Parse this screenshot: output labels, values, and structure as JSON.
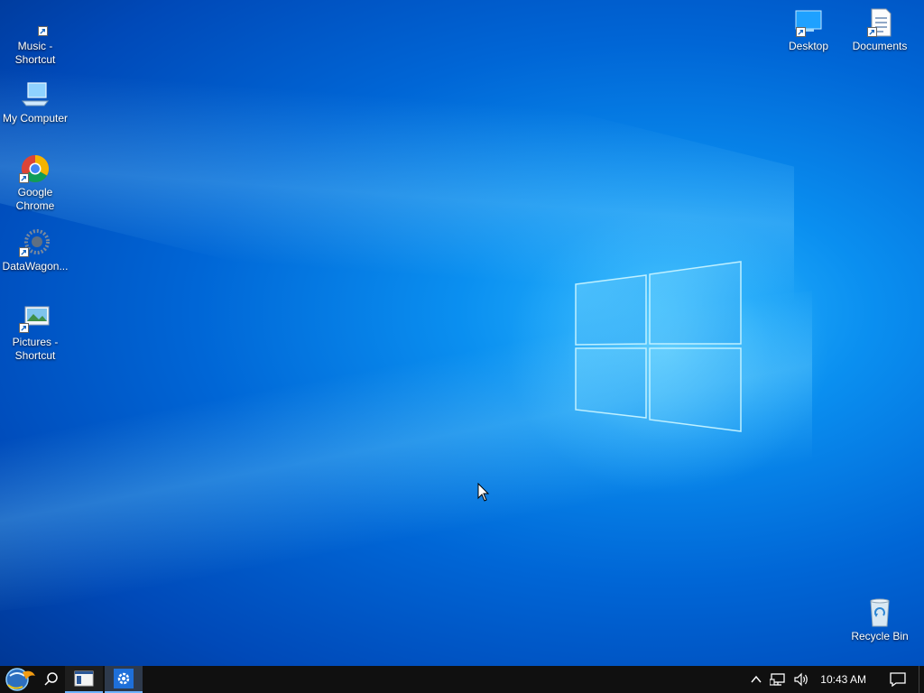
{
  "desktop": {
    "left_icons": [
      {
        "label": "Music - Shortcut",
        "icon": "music-shortcut-icon"
      },
      {
        "label": "My Computer",
        "icon": "computer-icon"
      },
      {
        "label": "Google Chrome",
        "icon": "chrome-icon"
      },
      {
        "label": "DataWagon...",
        "icon": "datawagon-icon"
      },
      {
        "label": "Pictures - Shortcut",
        "icon": "pictures-icon"
      }
    ],
    "right_icons": [
      {
        "label": "Desktop",
        "icon": "desktop-folder-icon"
      },
      {
        "label": "Documents",
        "icon": "documents-icon"
      }
    ],
    "recycle_bin": {
      "label": "Recycle Bin",
      "icon": "recycle-bin-icon"
    }
  },
  "taskbar": {
    "clock": "10:43 AM",
    "tray_icons": [
      "chevron-up-icon",
      "network-icon",
      "volume-icon"
    ],
    "notification_icon": "notification-icon"
  },
  "colors": {
    "accent": "#0078d7",
    "taskbar": "#101010"
  }
}
